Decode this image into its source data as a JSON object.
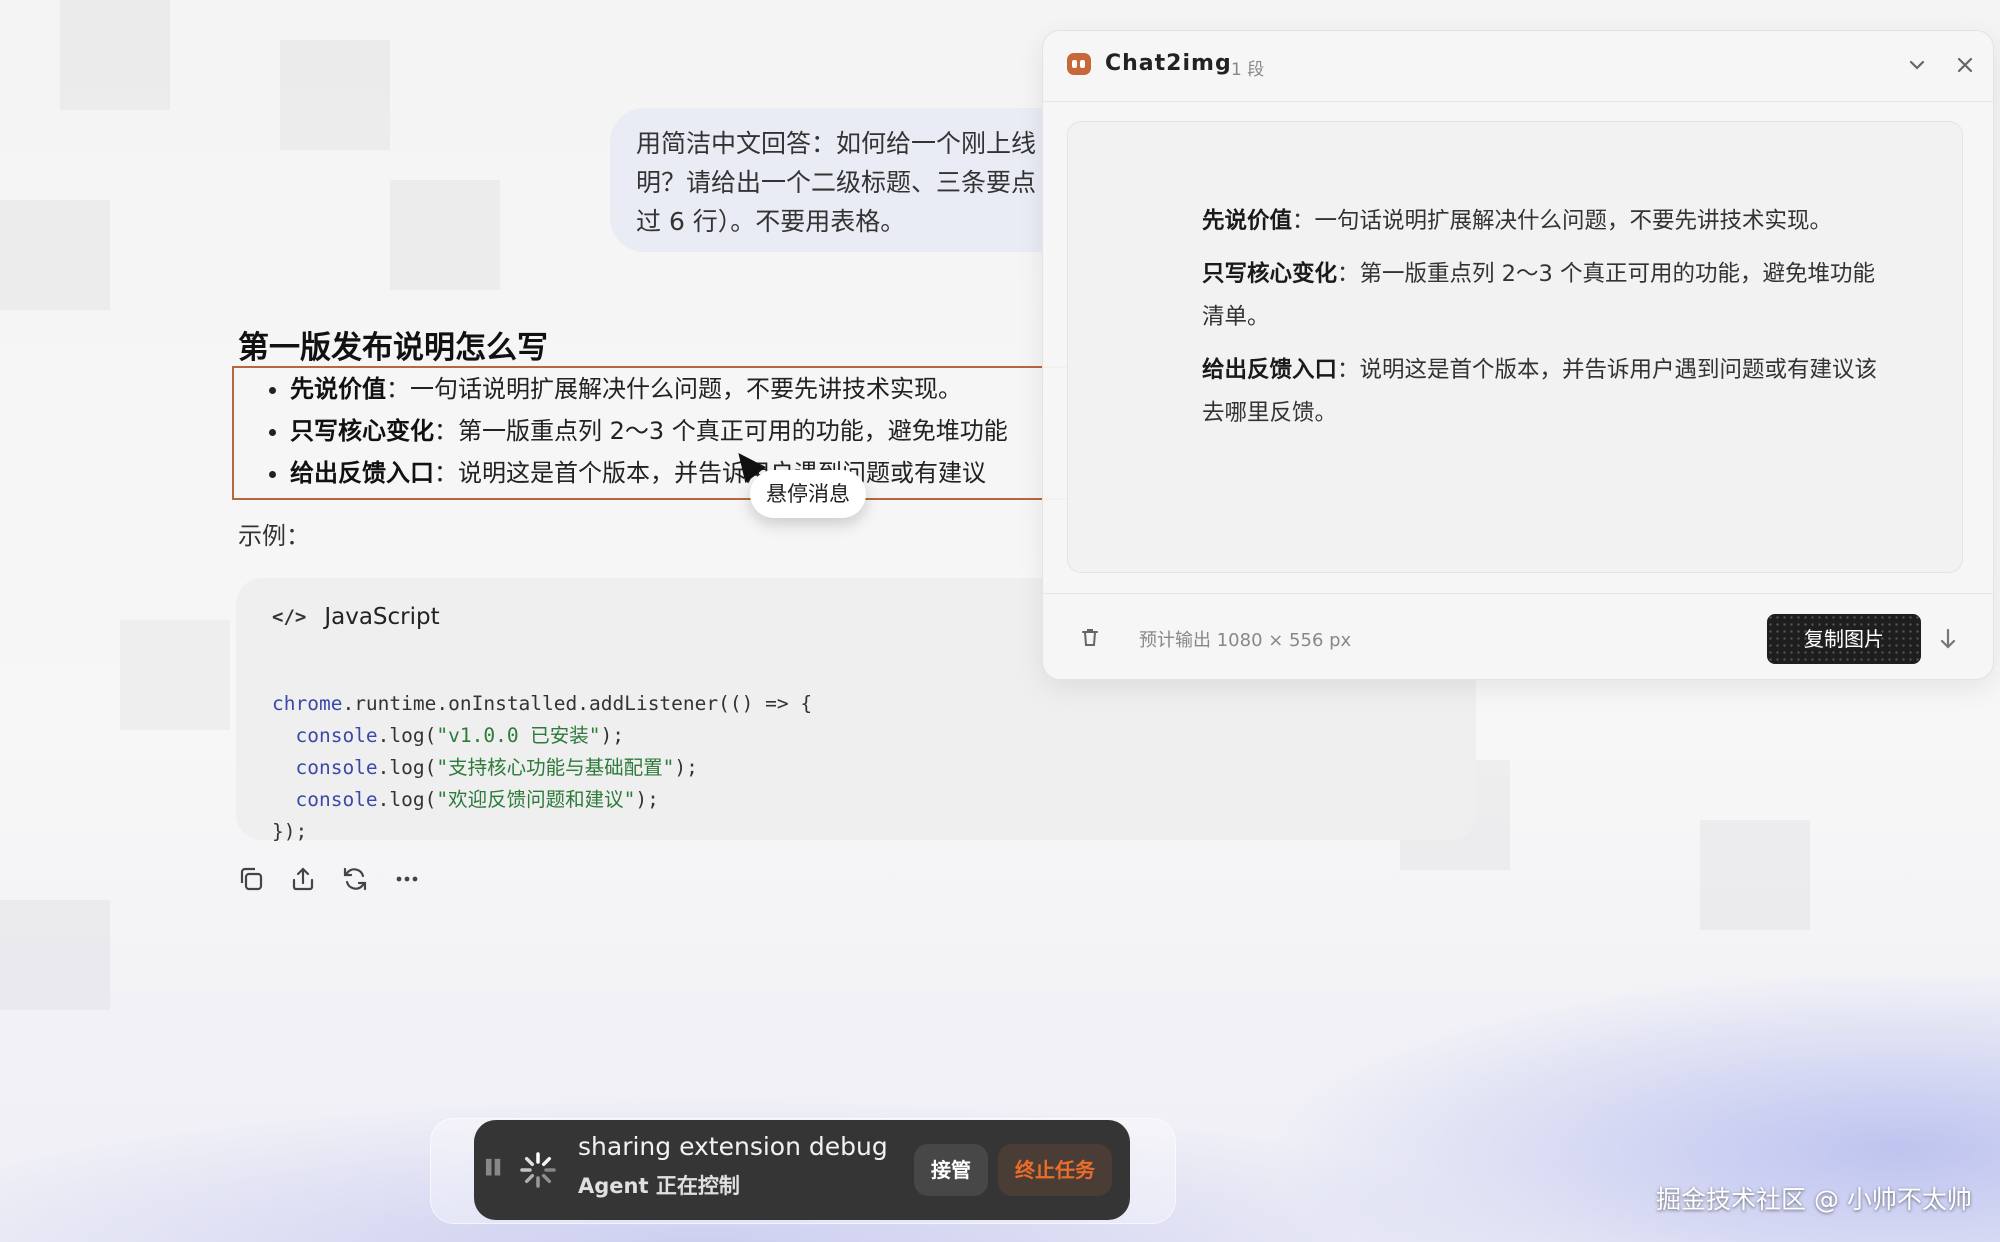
{
  "user_message": {
    "lines": [
      "用简洁中文回答：如何给一个刚上线",
      "明？请给出一个二级标题、三条要点",
      "过 6 行）。不要用表格。"
    ]
  },
  "answer": {
    "title": "第一版发布说明怎么写",
    "bullets": [
      {
        "bold": "先说价值",
        "text": "：一句话说明扩展解决什么问题，不要先讲技术实现。"
      },
      {
        "bold": "只写核心变化",
        "text": "：第一版重点列 2～3 个真正可用的功能，避免堆功能"
      },
      {
        "bold": "给出反馈入口",
        "text": "：说明这是首个版本，并告诉用户遇到问题或有建议"
      }
    ],
    "example_label": "示例：",
    "code": {
      "language": "JavaScript",
      "lines": [
        {
          "kw": "chrome",
          "rest": ".runtime.onInstalled.addListener(() => {",
          "str": "",
          "tail": ""
        },
        {
          "kw": "  console",
          "rest": ".log(",
          "str": "\"v1.0.0 已安装\"",
          "tail": ");"
        },
        {
          "kw": "  console",
          "rest": ".log(",
          "str": "\"支持核心功能与基础配置\"",
          "tail": ");"
        },
        {
          "kw": "  console",
          "rest": ".log(",
          "str": "\"欢迎反馈问题和建议\"",
          "tail": ");"
        },
        {
          "kw": "",
          "rest": "});",
          "str": "",
          "tail": ""
        }
      ]
    }
  },
  "hover_tooltip": "悬停消息",
  "panel": {
    "title": "Chat2img",
    "count": "1 段",
    "preview": [
      {
        "bold": "先说价值",
        "text": "：一句话说明扩展解决什么问题，不要先讲技术实现。"
      },
      {
        "bold": "只写核心变化",
        "text": "：第一版重点列 2～3 个真正可用的功能，避免堆功能清单。"
      },
      {
        "bold": "给出反馈入口",
        "text": "：说明这是首个版本，并告诉用户遇到问题或有建议该去哪里反馈。"
      }
    ],
    "estimate": "预计输出 1080 × 556 px",
    "copy_button": "复制图片"
  },
  "agent_bar": {
    "title": "sharing extension debug",
    "subtitle": "Agent 正在控制",
    "takeover": "接管",
    "stop": "终止任务"
  },
  "watermark": "掘金技术社区 @ 小帅不太帅",
  "colors": {
    "accent": "#b5683d",
    "stop_text": "#ec6c2a",
    "code_keyword": "#3b4aa8",
    "code_string": "#2d7a3a"
  },
  "icons": [
    "copy-icon",
    "share-icon",
    "regenerate-icon",
    "more-icon",
    "code-icon",
    "chevron-down-icon",
    "close-icon",
    "trash-icon",
    "download-icon",
    "spinner-icon",
    "pause-icon"
  ]
}
